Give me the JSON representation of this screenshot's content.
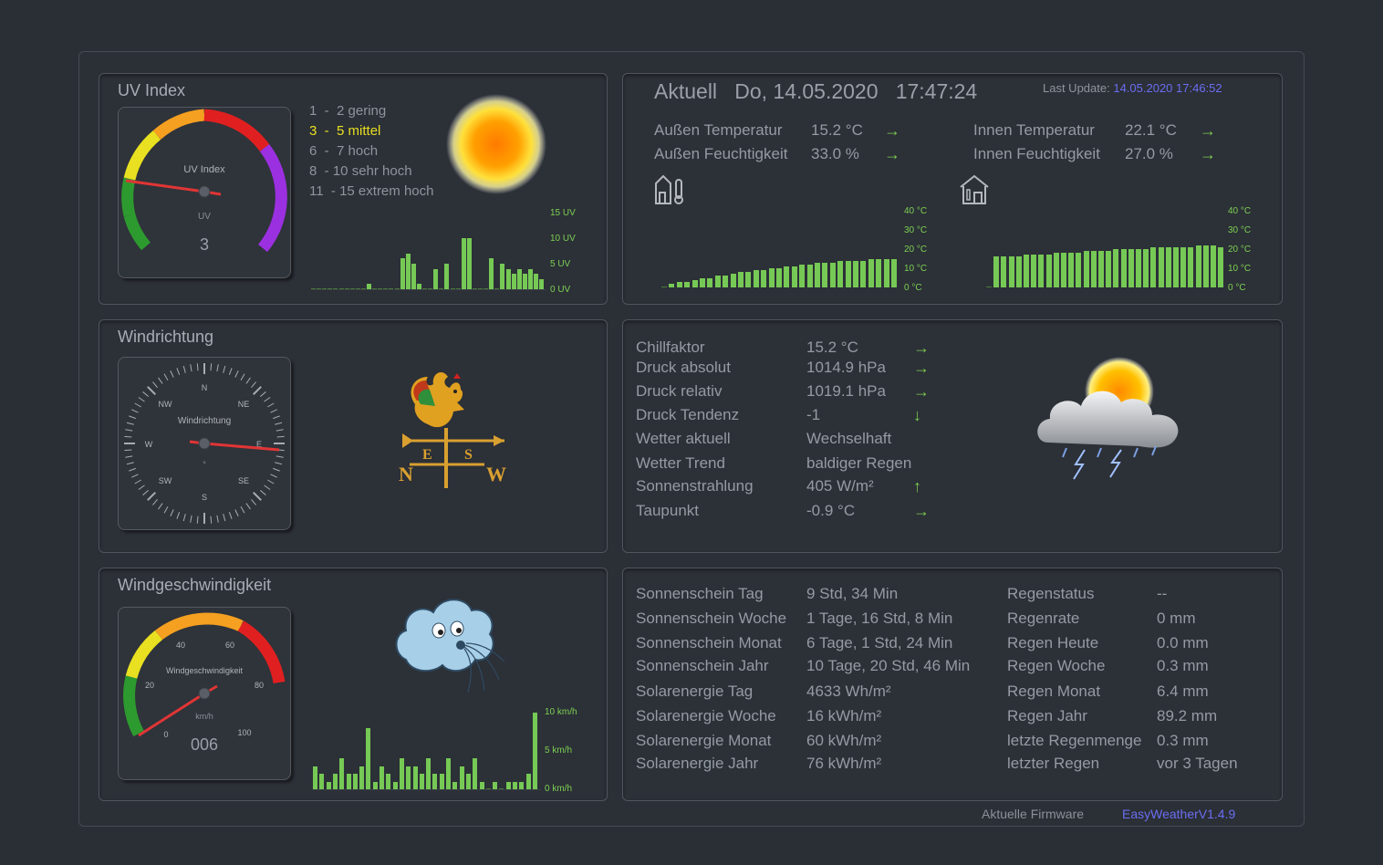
{
  "uv": {
    "title": "UV Index",
    "gauge_title": "UV Index",
    "gauge_unit": "UV",
    "gauge_value": "3",
    "gauge_numeric": 3,
    "scale": [
      {
        "range": "1  -  ",
        "label": "2 gering",
        "highlight": false
      },
      {
        "range": "3  -  ",
        "label": "5 mittel",
        "highlight": true
      },
      {
        "range": "6  -  ",
        "label": "7 hoch",
        "highlight": false
      },
      {
        "range": "8  - ",
        "label": "10 sehr hoch",
        "highlight": false
      },
      {
        "range": "11  - ",
        "label": "15 extrem hoch",
        "highlight": false
      }
    ],
    "axis": [
      "15 UV",
      "10 UV",
      "5 UV",
      "0 UV"
    ],
    "chart_data": [
      0,
      0,
      0,
      0,
      0,
      0,
      0,
      0,
      0,
      0,
      1,
      0,
      0,
      0,
      0,
      0,
      6,
      7,
      5,
      1,
      0,
      0,
      4,
      0,
      5,
      0,
      0,
      10,
      10,
      0,
      0,
      0,
      6,
      0,
      5,
      4,
      3,
      4,
      3,
      4,
      3,
      2
    ]
  },
  "current": {
    "label": "Aktuell",
    "date": "Do, 14.05.2020",
    "time": "17:47:24",
    "last_update_label": "Last Update:",
    "last_update_value": "14.05.2020 17:46:52",
    "rows_left": [
      {
        "label": "Außen Temperatur",
        "value": "15.2 °C",
        "arrow": "→"
      },
      {
        "label": "Außen Feuchtigkeit",
        "value": "33.0 %",
        "arrow": "→"
      }
    ],
    "rows_right": [
      {
        "label": "Innen Temperatur",
        "value": "22.1 °C",
        "arrow": "→"
      },
      {
        "label": "Innen Feuchtigkeit",
        "value": "27.0 %",
        "arrow": "→"
      }
    ],
    "temp_axis": [
      "40 °C",
      "30 °C",
      "20 °C",
      "10 °C",
      "0 °C"
    ],
    "outdoor_chart": [
      0,
      2,
      3,
      3,
      4,
      5,
      5,
      6,
      6,
      7,
      8,
      8,
      9,
      9,
      10,
      10,
      11,
      11,
      12,
      12,
      13,
      13,
      13,
      14,
      14,
      14,
      14,
      15,
      15,
      15,
      15
    ],
    "indoor_chart": [
      0,
      16,
      16,
      16,
      16,
      17,
      17,
      17,
      17,
      18,
      18,
      18,
      18,
      19,
      19,
      19,
      19,
      20,
      20,
      20,
      20,
      20,
      21,
      21,
      21,
      21,
      21,
      21,
      22,
      22,
      22,
      21
    ]
  },
  "wind_dir": {
    "title": "Windrichtung",
    "gauge_title": "Windrichtung",
    "labels": {
      "N": "N",
      "NE": "NE",
      "E": "E",
      "SE": "SE",
      "S": "S",
      "SW": "SW",
      "W": "W",
      "NW": "NW"
    },
    "unit": "°"
  },
  "weather": {
    "rows": [
      {
        "label": "Chillfaktor",
        "value": "15.2 °C",
        "arrow": "→"
      },
      {
        "label": "Druck absolut",
        "value": "1014.9 hPa",
        "arrow": "→"
      },
      {
        "label": "Druck relativ",
        "value": "1019.1 hPa",
        "arrow": "→"
      },
      {
        "label": "Druck Tendenz",
        "value": "-1",
        "arrow": "↓"
      },
      {
        "label": "Wetter aktuell",
        "value": "Wechselhaft",
        "arrow": ""
      },
      {
        "label": "Wetter Trend",
        "value": "baldiger Regen",
        "arrow": ""
      },
      {
        "label": "Sonnenstrahlung",
        "value": "405 W/m²",
        "arrow": "↑"
      },
      {
        "label": "Taupunkt",
        "value": "-0.9 °C",
        "arrow": "→"
      }
    ]
  },
  "wind_speed": {
    "title": "Windgeschwindigkeit",
    "gauge_title": "Windgeschwindigkeit",
    "gauge_unit": "km/h",
    "gauge_value": "006",
    "gauge_numeric": 6,
    "ticks": [
      "0",
      "20",
      "40",
      "60",
      "80",
      "100"
    ],
    "axis": [
      "10 km/h",
      "5 km/h",
      "0 km/h"
    ],
    "chart_data": [
      3,
      2,
      1,
      2,
      4,
      2,
      2,
      3,
      8,
      1,
      3,
      2,
      1,
      4,
      3,
      3,
      2,
      4,
      2,
      2,
      4,
      1,
      3,
      2,
      4,
      1,
      0,
      1,
      0,
      1,
      1,
      1,
      2,
      10
    ]
  },
  "stats": {
    "left": [
      {
        "label": "Sonnenschein Tag",
        "value": "9 Std, 34 Min"
      },
      {
        "label": "Sonnenschein Woche",
        "value": "1 Tage, 16 Std, 8 Min"
      },
      {
        "label": "Sonnenschein Monat",
        "value": "6 Tage, 1 Std, 24 Min"
      },
      {
        "label": "Sonnenschein Jahr",
        "value": "10 Tage, 20 Std, 46 Min"
      },
      {
        "label": "Solarenergie Tag",
        "value": "4633 Wh/m²"
      },
      {
        "label": "Solarenergie Woche",
        "value": "16 kWh/m²"
      },
      {
        "label": "Solarenergie Monat",
        "value": "60 kWh/m²"
      },
      {
        "label": "Solarenergie Jahr",
        "value": "76 kWh/m²"
      }
    ],
    "right": [
      {
        "label": "Regenstatus",
        "value": "--"
      },
      {
        "label": "Regenrate",
        "value": "0 mm"
      },
      {
        "label": "Regen Heute",
        "value": "0.0 mm"
      },
      {
        "label": "Regen Woche",
        "value": "0.3 mm"
      },
      {
        "label": "Regen Monat",
        "value": "6.4 mm"
      },
      {
        "label": "Regen Jahr",
        "value": "89.2 mm"
      },
      {
        "label": "letzte Regenmenge",
        "value": "0.3 mm"
      },
      {
        "label": "letzter Regen",
        "value": "vor 3 Tagen"
      }
    ]
  },
  "footer": {
    "firmware_label": "Aktuelle Firmware",
    "firmware_value": "EasyWeatherV1.4.9"
  }
}
